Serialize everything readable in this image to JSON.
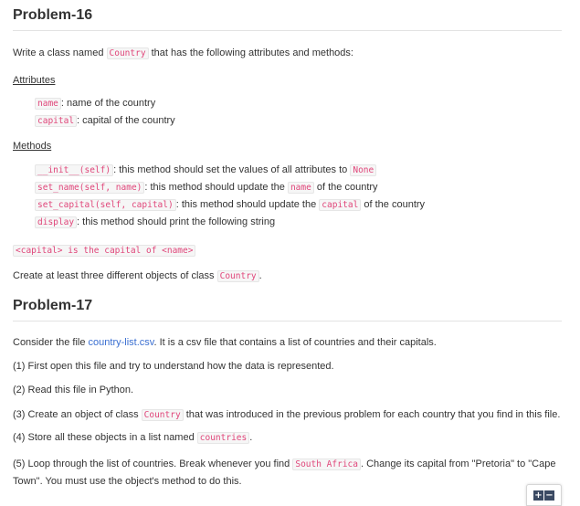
{
  "p16": {
    "title": "Problem-16",
    "intro_pre": "Write a class named ",
    "intro_code": "Country",
    "intro_post": " that has the following attributes and methods:",
    "attributes_label": "Attributes",
    "attributes": [
      {
        "code": "name",
        "text": ": name of the country"
      },
      {
        "code": "capital",
        "text": ": capital of the country"
      }
    ],
    "methods_label": "Methods",
    "methods": [
      {
        "code": "__init__(self)",
        "text": ": this method should set the values of all attributes to ",
        "code2": "None",
        "text2": ""
      },
      {
        "code": "set_name(self, name)",
        "text": ": this method should update the ",
        "code2": "name",
        "text2": " of the country"
      },
      {
        "code": "set_capital(self, capital)",
        "text": ": this method should update the ",
        "code2": "capital",
        "text2": " of the country"
      },
      {
        "code": "display",
        "text": ": this method should print the following string",
        "code2": "",
        "text2": ""
      }
    ],
    "display_string": "<capital> is the capital of <name>",
    "closing_pre": "Create at least three different objects of class ",
    "closing_code": "Country",
    "closing_post": "."
  },
  "p17": {
    "title": "Problem-17",
    "intro_pre": "Consider the file ",
    "intro_link": "country-list.csv",
    "intro_post": ". It is a csv file that contains a list of countries and their capitals.",
    "step1": "(1) First open this file and try to understand how the data is represented.",
    "step2": "(2) Read this file in Python.",
    "step3_pre": "(3) Create an object of class ",
    "step3_code": "Country",
    "step3_post": " that was introduced in the previous problem for each country that you find in this file.",
    "step4_pre": "(4) Store all these objects in a list named ",
    "step4_code": "countries",
    "step4_post": ".",
    "step5_pre": "(5) Loop through the list of countries. Break whenever you find ",
    "step5_code": "South Africa",
    "step5_post": ". Change its capital from \"Pretoria\" to \"Cape Town\". You must use the object's method to do this."
  },
  "zoom": {
    "in_label": "+",
    "out_label": "−"
  }
}
